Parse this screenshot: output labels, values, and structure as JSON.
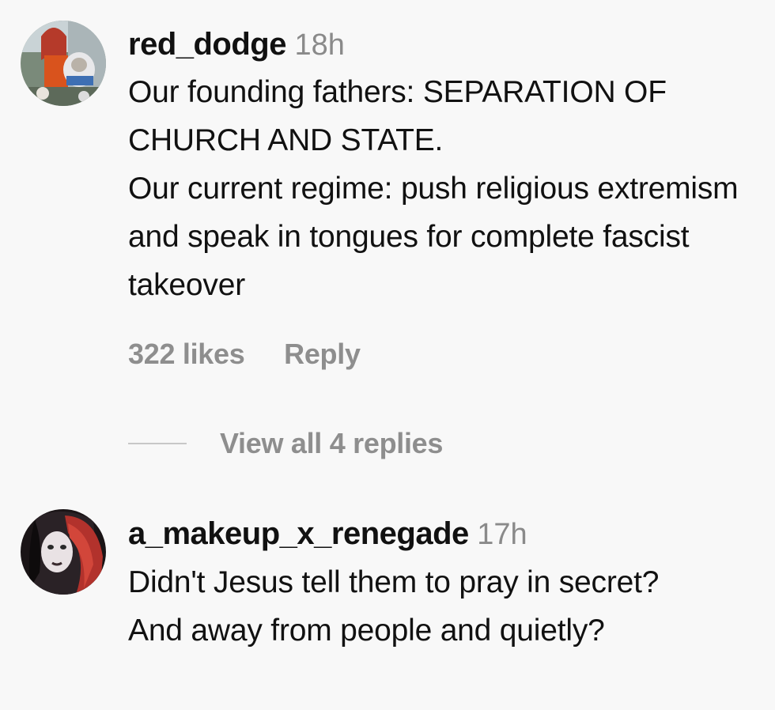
{
  "comments": [
    {
      "username": "red_dodge",
      "time": "18h",
      "lines": [
        "Our founding fathers: SEPARATION OF CHURCH AND STATE.",
        "Our current regime: push religious extremism and speak in tongues for complete fascist takeover"
      ],
      "likes": "322 likes",
      "reply_label": "Reply",
      "view_replies": "View all 4 replies",
      "avatar_icon": "user-avatar-photo"
    },
    {
      "username": "a_makeup_x_renegade",
      "time": "17h",
      "lines": [
        "Didn't Jesus tell them to pray in secret? And away from people and quietly?"
      ],
      "avatar_icon": "user-avatar-photo"
    }
  ],
  "colors": {
    "background": "#f8f8f8",
    "text": "#111111",
    "muted": "#8e8e8e"
  }
}
